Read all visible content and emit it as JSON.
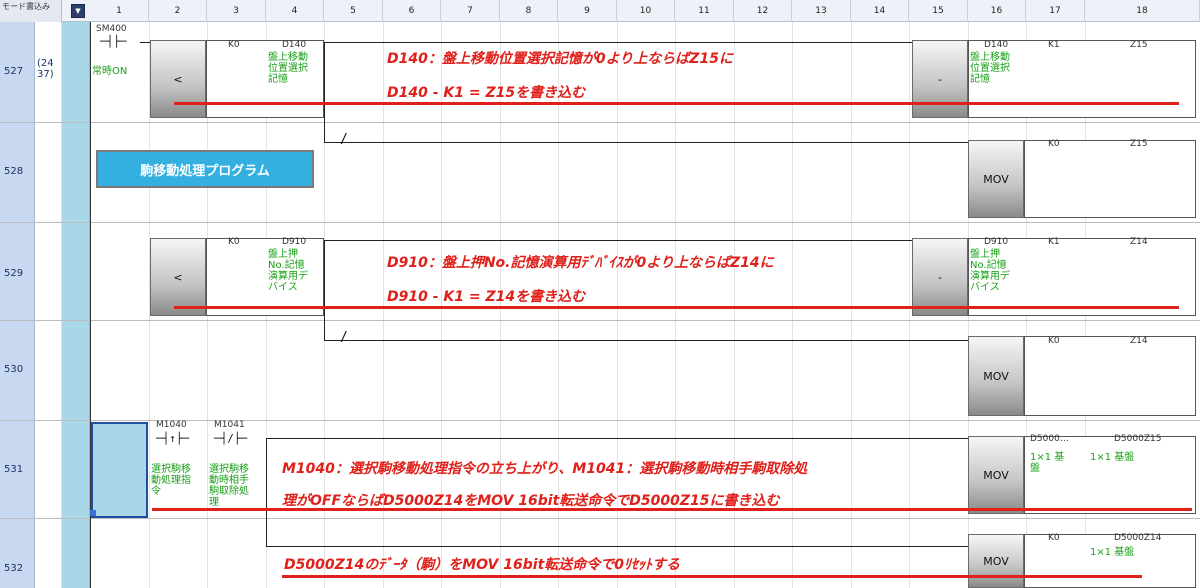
{
  "header": {
    "mode_label": "モード書込み",
    "dropdown_icon": "chevron-down-icon",
    "columns": [
      "1",
      "2",
      "3",
      "4",
      "5",
      "6",
      "7",
      "8",
      "9",
      "10",
      "11",
      "12",
      "13",
      "14",
      "15",
      "16",
      "17",
      "18"
    ]
  },
  "rows": [
    {
      "step": "527",
      "row": {
        "step_note": "(24\n37)",
        "sm_label": "SM400",
        "sm_comment": "常時ON",
        "left_op": "<",
        "k_label": "K0",
        "d_label": "D140",
        "d_comment": "盤上移動\n位置選択\n記憶",
        "right_op": "-",
        "r1_label": "D140",
        "r1_comment": "盤上移動\n位置選択\n記憶",
        "r2_label": "K1",
        "r3_label": "Z15"
      }
    },
    {
      "step": "528",
      "row": {
        "op": "MOV",
        "r2_label": "K0",
        "r3_label": "Z15"
      }
    },
    {
      "step": "529",
      "row": {
        "left_op": "<",
        "k_label": "K0",
        "d_label": "D910",
        "d_comment": "盤上押\nNo.記憶\n演算用デ\nバイス",
        "right_op": "-",
        "r1_label": "D910",
        "r1_comment": "盤上押\nNo.記憶\n演算用デ\nバイス",
        "r2_label": "K1",
        "r3_label": "Z14"
      }
    },
    {
      "step": "530",
      "row": {
        "op": "MOV",
        "r2_label": "K0",
        "r3_label": "Z14"
      }
    },
    {
      "step": "531",
      "row": {
        "c1_label": "M1040",
        "c1_comment": "選択駒移\n動処理指\n令",
        "c2_label": "M1041",
        "c2_comment": "選択駒移\n動時相手\n駒取除処\n理",
        "op": "MOV",
        "r1_label": "D5000…",
        "r1_comment": "1×1 基\n盤",
        "r2_label": "D5000Z15",
        "r2_comment": "1×1 基盤"
      }
    },
    {
      "step": "532",
      "row": {
        "op": "MOV",
        "r1_label": "K0",
        "r2_label": "D5000Z14",
        "r2_comment": "1×1 基盤"
      }
    }
  ],
  "title_box": "駒移動処理プログラム",
  "annotations": {
    "a527_1": "D140：盤上移動位置選択記憶が0より上ならばZ15に",
    "a527_2": "D140 - K1 = Z15を書き込む",
    "a529_1": "D910：盤上押No.記憶演算用ﾃﾞﾊﾞｲｽが0より上ならばZ14に",
    "a529_2": "D910 - K1 = Z14を書き込む",
    "a531_1": "M1040：選択駒移動処理指令の立ち上がり、M1041：選択駒移動時相手駒取除処",
    "a531_2": "理がOFFならばD5000Z14をMOV 16bit転送命令でD5000Z15に書き込む",
    "a532_1": "D5000Z14のﾃﾞｰﾀ（駒）をMOV 16bit転送命令で0ﾘｾｯﾄする"
  },
  "colors": {
    "accent_red": "#e0201a",
    "comment_green": "#18a018",
    "title_blue": "#34b0e0",
    "step_blue": "#c8d8f0",
    "bar_cyan": "#a9d7e8"
  }
}
